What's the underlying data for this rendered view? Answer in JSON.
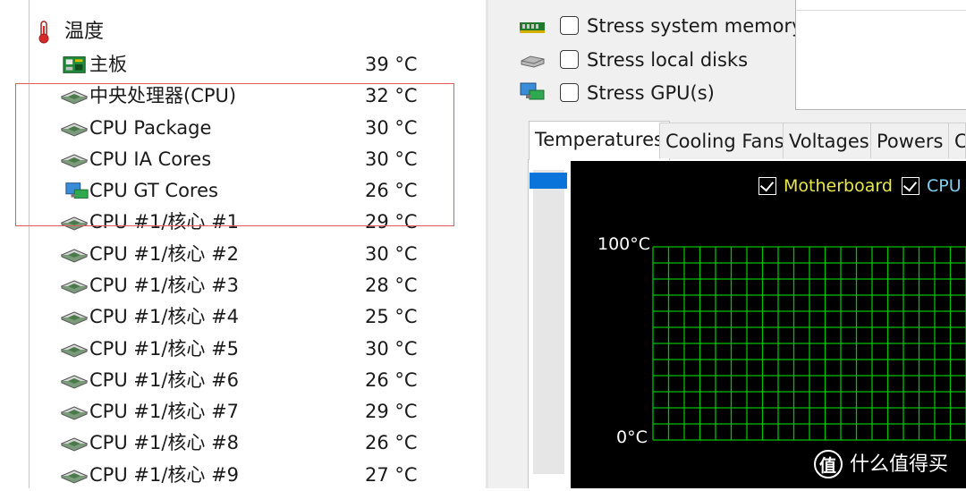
{
  "sensor_tree": {
    "category_label": "温度",
    "rows": [
      {
        "label": "主板",
        "value": "39 °C",
        "icon": "motherboard-icon"
      },
      {
        "label": "中央处理器(CPU)",
        "value": "32 °C",
        "icon": "cpu-chip-icon"
      },
      {
        "label": "CPU Package",
        "value": "30 °C",
        "icon": "cpu-chip-icon"
      },
      {
        "label": "CPU IA Cores",
        "value": "30 °C",
        "icon": "cpu-chip-icon"
      },
      {
        "label": "CPU GT Cores",
        "value": "26 °C",
        "icon": "gpu-monitor-icon"
      },
      {
        "label": "CPU #1/核心 #1",
        "value": "29 °C",
        "icon": "cpu-chip-icon"
      },
      {
        "label": "CPU #1/核心 #2",
        "value": "30 °C",
        "icon": "cpu-chip-icon"
      },
      {
        "label": "CPU #1/核心 #3",
        "value": "28 °C",
        "icon": "cpu-chip-icon"
      },
      {
        "label": "CPU #1/核心 #4",
        "value": "25 °C",
        "icon": "cpu-chip-icon"
      },
      {
        "label": "CPU #1/核心 #5",
        "value": "30 °C",
        "icon": "cpu-chip-icon"
      },
      {
        "label": "CPU #1/核心 #6",
        "value": "26 °C",
        "icon": "cpu-chip-icon"
      },
      {
        "label": "CPU #1/核心 #7",
        "value": "29 °C",
        "icon": "cpu-chip-icon"
      },
      {
        "label": "CPU #1/核心 #8",
        "value": "26 °C",
        "icon": "cpu-chip-icon"
      },
      {
        "label": "CPU #1/核心 #9",
        "value": "27 °C",
        "icon": "cpu-chip-icon"
      }
    ]
  },
  "stress_options": [
    {
      "label": "Stress system memory",
      "checked": false,
      "icon": "memory-icon"
    },
    {
      "label": "Stress local disks",
      "checked": false,
      "icon": "disk-icon"
    },
    {
      "label": "Stress GPU(s)",
      "checked": false,
      "icon": "gpu-monitor-icon"
    }
  ],
  "tabs": [
    {
      "label": "Temperatures",
      "active": true
    },
    {
      "label": "Cooling Fans",
      "active": false
    },
    {
      "label": "Voltages",
      "active": false
    },
    {
      "label": "Powers",
      "active": false
    },
    {
      "label": "C",
      "active": false
    }
  ],
  "graph": {
    "legend": [
      {
        "label": "Motherboard",
        "checked": true,
        "color": "#e8e84a"
      },
      {
        "label": "CPU",
        "checked": true,
        "color": "#7fd0f0"
      }
    ],
    "y_max_label": "100°C",
    "y_min_label": "0°C",
    "grid_color": "#00c000",
    "background": "#000000"
  },
  "watermark": {
    "symbol": "值",
    "text": "什么值得买"
  },
  "colors": {
    "highlight": "#e25a5a",
    "scroll_thumb": "#0a74da"
  }
}
